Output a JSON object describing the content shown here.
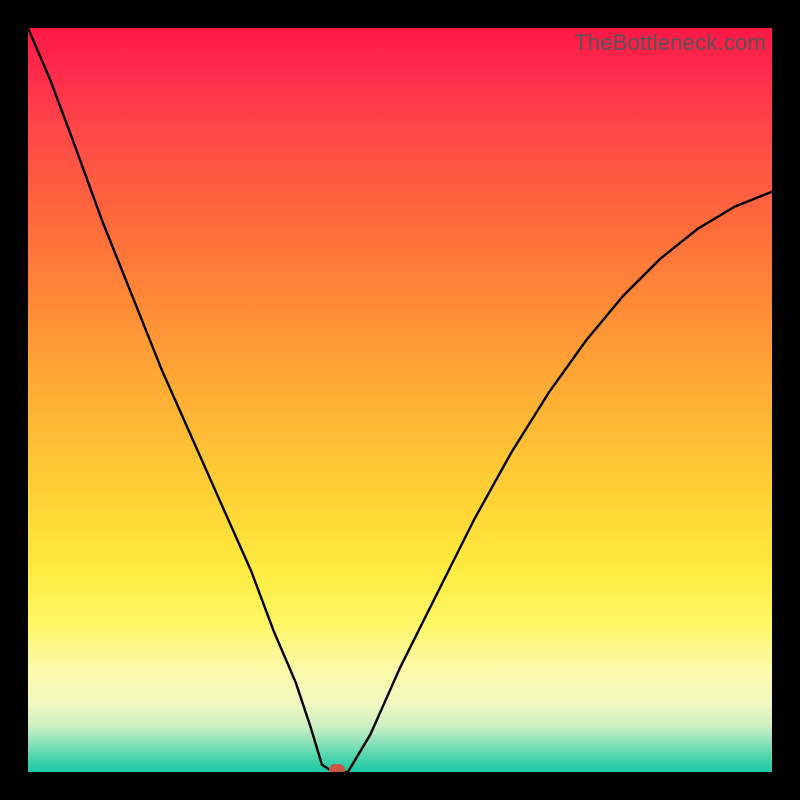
{
  "watermark": "TheBottleneck.com",
  "chart_data": {
    "type": "line",
    "title": "",
    "xlabel": "",
    "ylabel": "",
    "xlim": [
      0,
      100
    ],
    "ylim": [
      0,
      100
    ],
    "series": [
      {
        "name": "bottleneck-curve",
        "x": [
          0,
          3,
          6,
          10,
          14,
          18,
          22,
          26,
          30,
          33,
          36,
          38,
          39.5,
          41,
          43,
          46,
          50,
          55,
          60,
          65,
          70,
          75,
          80,
          85,
          90,
          95,
          100
        ],
        "values": [
          100,
          93,
          85,
          74,
          64,
          54,
          45,
          36,
          27,
          19,
          12,
          6,
          1,
          0,
          0,
          5,
          14,
          24,
          34,
          43,
          51,
          58,
          64,
          69,
          73,
          76,
          78
        ]
      }
    ],
    "marker": {
      "x": 41.5,
      "y": 0,
      "color": "#c85640"
    },
    "background_gradient": {
      "stops": [
        {
          "pos": 0.0,
          "color": "#ff1846"
        },
        {
          "pos": 0.06,
          "color": "#ff2b4c"
        },
        {
          "pos": 0.14,
          "color": "#ff4848"
        },
        {
          "pos": 0.26,
          "color": "#ff6a3c"
        },
        {
          "pos": 0.38,
          "color": "#ff8d36"
        },
        {
          "pos": 0.5,
          "color": "#ffb035"
        },
        {
          "pos": 0.62,
          "color": "#ffd035"
        },
        {
          "pos": 0.72,
          "color": "#ffe93c"
        },
        {
          "pos": 0.8,
          "color": "#fff766"
        },
        {
          "pos": 0.86,
          "color": "#fcf9a8"
        },
        {
          "pos": 0.91,
          "color": "#f0f7c0"
        },
        {
          "pos": 0.94,
          "color": "#c9efc2"
        },
        {
          "pos": 0.96,
          "color": "#8ee2b9"
        },
        {
          "pos": 0.98,
          "color": "#4cd4ad"
        },
        {
          "pos": 1.0,
          "color": "#1bc9a5"
        }
      ]
    },
    "grid": false,
    "legend": false
  }
}
